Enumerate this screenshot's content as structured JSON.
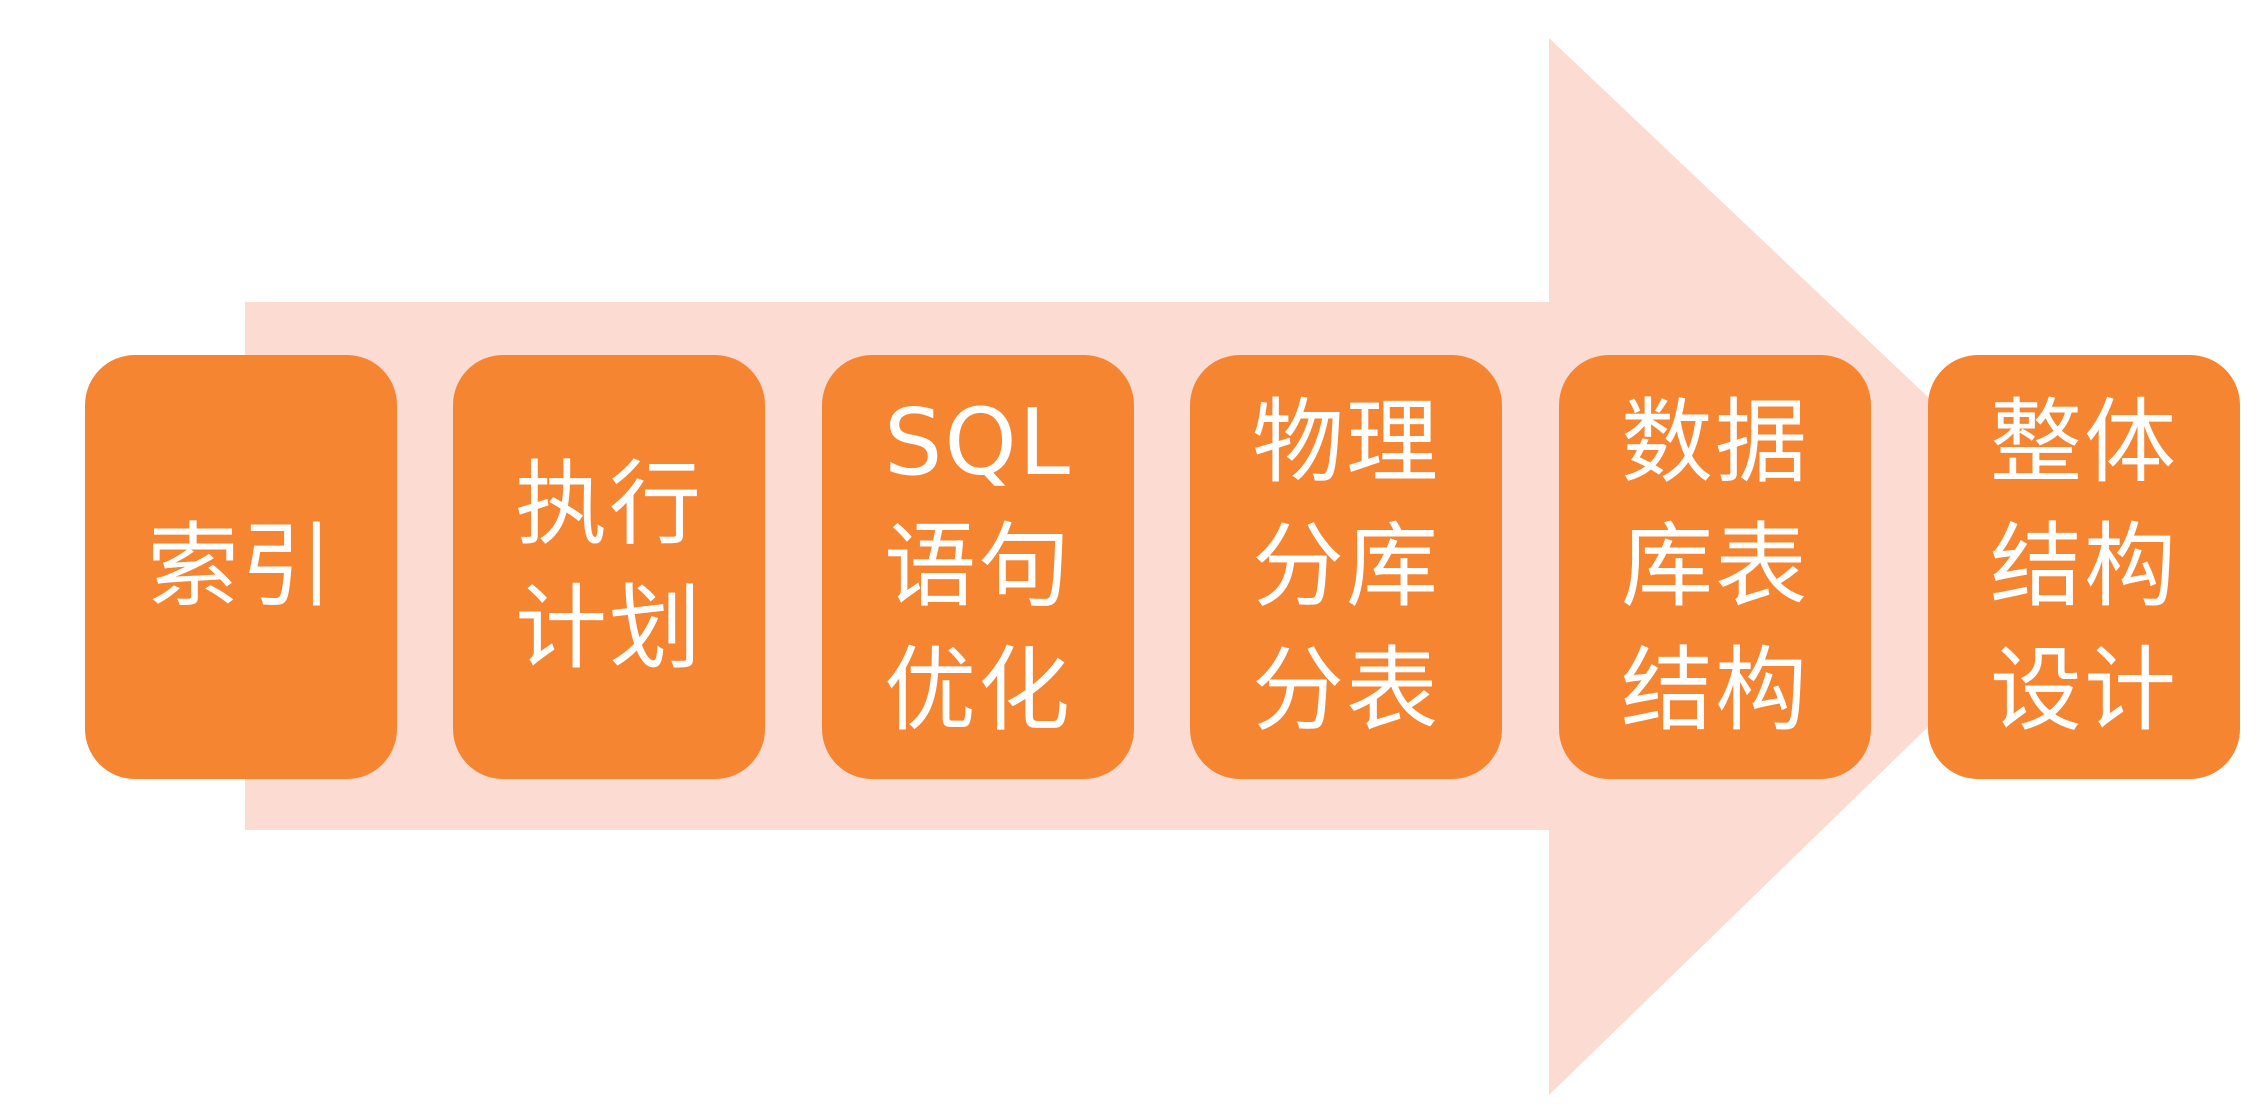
{
  "colors": {
    "arrow": "#fbdbd2",
    "box": "#f68532",
    "text": "#ffffff"
  },
  "steps": [
    {
      "label": "索引"
    },
    {
      "label": "执行\n计划"
    },
    {
      "label": "SQL\n语句\n优化"
    },
    {
      "label": "物理\n分库\n分表"
    },
    {
      "label": "数据\n库表\n结构"
    },
    {
      "label": "整体\n结构\n设计"
    }
  ]
}
